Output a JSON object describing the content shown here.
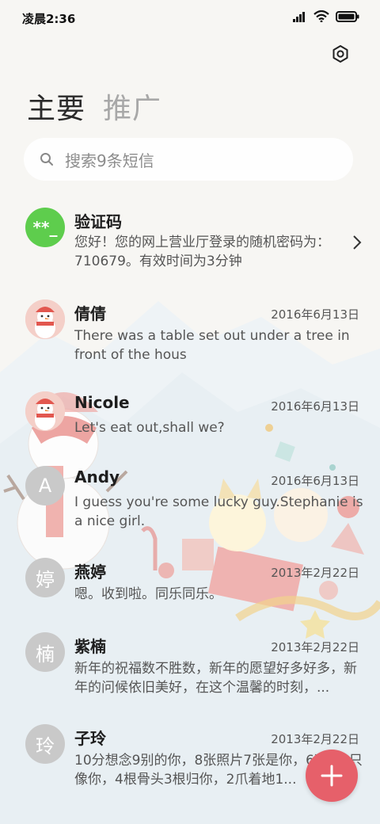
{
  "status_bar": {
    "time": "凌晨2:36"
  },
  "tabs": [
    {
      "label": "主要",
      "active": true
    },
    {
      "label": "推广",
      "active": false
    }
  ],
  "search": {
    "placeholder": "搜索9条短信"
  },
  "conversations": [
    {
      "name": "验证码",
      "avatar_text": "**_",
      "date": "",
      "preview": "您好！您的网上营业厅登录的随机密码为：710679。有效时间为3分钟"
    },
    {
      "name": "倩倩",
      "avatar_text": "",
      "date": "2016年6月13日",
      "preview": "There was a table set out under a tree in front of the hous"
    },
    {
      "name": "Nicole",
      "avatar_text": "",
      "date": "2016年6月13日",
      "preview": "Let's eat out,shall we?"
    },
    {
      "name": "Andy",
      "avatar_text": "A",
      "date": "2016年6月13日",
      "preview": "I guess you're some lucky guy.Stephanie is a nice girl."
    },
    {
      "name": "燕婷",
      "avatar_text": "婷",
      "date": "2013年2月22日",
      "preview": "嗯。收到啦。同乐同乐。"
    },
    {
      "name": "紫楠",
      "avatar_text": "楠",
      "date": "2013年2月22日",
      "preview": "新年的祝福数不胜数，新年的愿望好多好多，新年的问候依旧美好，在这个温馨的时刻，..."
    },
    {
      "name": "子玲",
      "avatar_text": "玲",
      "date": "2013年2月22日",
      "preview": "10分想念9别的你，8张照片7张是你，6次...5只像你，4根骨头3根归你，2爪着地1..."
    }
  ],
  "colors": {
    "fab": "#e6606a",
    "verify_avatar": "#5ecd4d",
    "placeholder_avatar": "#c9c9c9"
  }
}
